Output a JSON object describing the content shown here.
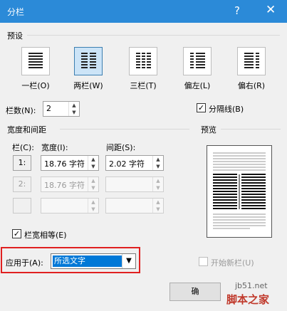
{
  "window": {
    "title": "分栏",
    "help": "?",
    "close": "✕"
  },
  "presets": {
    "label": "预设",
    "items": [
      {
        "name": "one",
        "label": "一栏(O)"
      },
      {
        "name": "two",
        "label": "两栏(W)",
        "selected": true
      },
      {
        "name": "three",
        "label": "三栏(T)"
      },
      {
        "name": "left",
        "label": "偏左(L)"
      },
      {
        "name": "right",
        "label": "偏右(R)"
      }
    ]
  },
  "columns": {
    "label": "栏数(N):",
    "value": "2"
  },
  "separator": {
    "label": "分隔线(B)",
    "checked": true,
    "mark": "✓"
  },
  "width_spacing": {
    "label": "宽度和间距",
    "col_header": "栏(C):",
    "width_header": "宽度(I):",
    "spacing_header": "间距(S):",
    "rows": [
      {
        "col": "1:",
        "width": "18.76 字符",
        "spacing": "2.02 字符"
      },
      {
        "col": "2:",
        "width": "18.76 字符",
        "spacing": ""
      },
      {
        "col": "",
        "width": "",
        "spacing": ""
      }
    ],
    "equal_width": {
      "label": "栏宽相等(E)",
      "checked": true,
      "mark": "✓"
    }
  },
  "preview": {
    "label": "预览"
  },
  "apply_to": {
    "label": "应用于(A):",
    "value": "所选文字"
  },
  "new_column": {
    "label": "开始新栏(U)",
    "checked": false
  },
  "ok": {
    "label": "确"
  },
  "watermark": {
    "line1": "jb51.net",
    "line2": "脚本之家"
  }
}
